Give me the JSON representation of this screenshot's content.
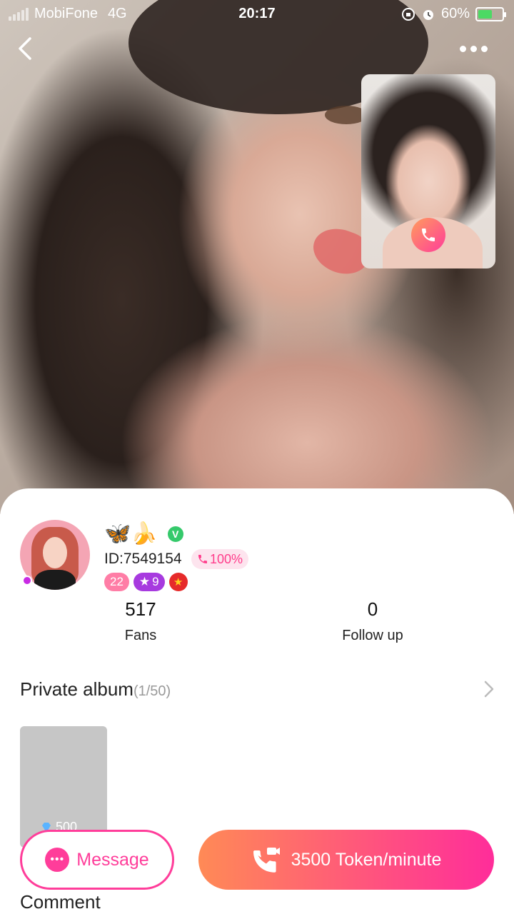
{
  "status_bar": {
    "carrier": "MobiFone",
    "network": "4G",
    "time": "20:17",
    "battery": "60%",
    "battery_level": 0.6
  },
  "profile": {
    "emojis": "🦋🍌",
    "verified_mark": "V",
    "id": "ID:7549154",
    "answer_rate": "100%",
    "level": "22",
    "vip_level": "9",
    "country_flag": "★"
  },
  "stats": {
    "fans_count": "517",
    "fans_label": "Fans",
    "follow_count": "0",
    "follow_label": "Follow up"
  },
  "album": {
    "title": "Private album",
    "count": "(1/50)",
    "thumb_price": "500"
  },
  "comment_title": "Comment",
  "actions": {
    "message_label": "Message",
    "call_label": "3500 Token/minute"
  },
  "colors": {
    "accent": "#ff3d9a",
    "gradient_start": "#ff8a56",
    "gradient_end": "#ff2d9a"
  }
}
